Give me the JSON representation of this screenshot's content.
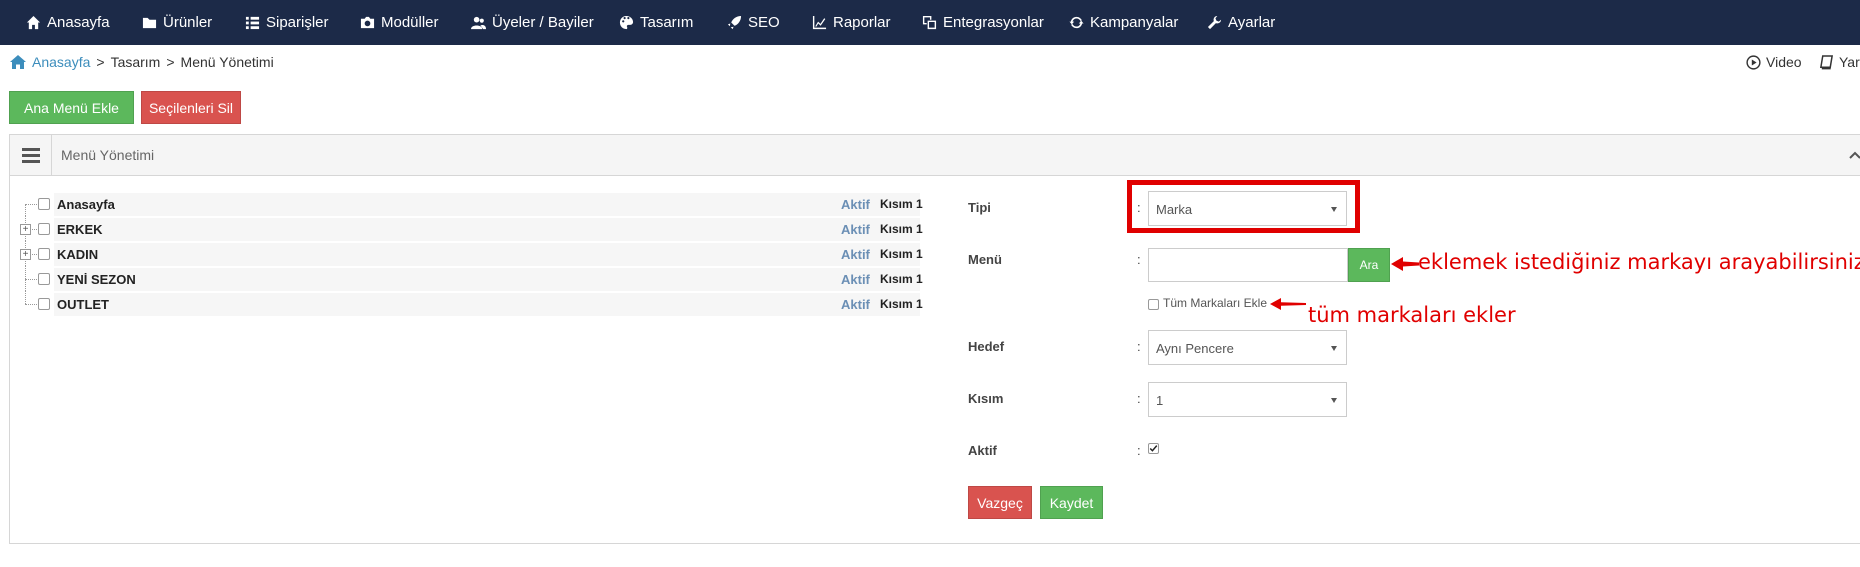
{
  "nav": {
    "items": [
      {
        "label": "Anasayfa",
        "icon": "home-icon"
      },
      {
        "label": "Ürünler",
        "icon": "folder-icon"
      },
      {
        "label": "Siparişler",
        "icon": "list-icon"
      },
      {
        "label": "Modüller",
        "icon": "module-icon"
      },
      {
        "label": "Üyeler / Bayiler",
        "icon": "users-icon"
      },
      {
        "label": "Tasarım",
        "icon": "palette-icon"
      },
      {
        "label": "SEO",
        "icon": "rocket-icon"
      },
      {
        "label": "Raporlar",
        "icon": "chart-icon"
      },
      {
        "label": "Entegrasyonlar",
        "icon": "integration-icon"
      },
      {
        "label": "Kampanyalar",
        "icon": "refresh-icon"
      },
      {
        "label": "Ayarlar",
        "icon": "wrench-icon"
      }
    ]
  },
  "breadcrumb": {
    "home": "Anasayfa",
    "items": [
      "Tasarım",
      "Menü Yönetimi"
    ],
    "separator": ">"
  },
  "top_right": {
    "video": "Video",
    "help": "Yard"
  },
  "toolbar": {
    "add_main_menu": "Ana Menü Ekle",
    "delete_selected": "Seçilenleri Sil"
  },
  "panel": {
    "title": "Menü Yönetimi"
  },
  "tree": {
    "rows": [
      {
        "name": "Anasayfa",
        "status": "Aktif",
        "section": "Kısım 1",
        "expandable": false
      },
      {
        "name": "ERKEK",
        "status": "Aktif",
        "section": "Kısım 1",
        "expandable": true
      },
      {
        "name": "KADIN",
        "status": "Aktif",
        "section": "Kısım 1",
        "expandable": true
      },
      {
        "name": "YENİ SEZON",
        "status": "Aktif",
        "section": "Kısım 1",
        "expandable": false
      },
      {
        "name": "OUTLET",
        "status": "Aktif",
        "section": "Kısım 1",
        "expandable": false
      }
    ]
  },
  "form": {
    "colon": ":",
    "type_label": "Tipi",
    "type_value": "Marka",
    "menu_label": "Menü",
    "menu_value": "",
    "search_button": "Ara",
    "all_brands_label": "Tüm Markaları Ekle",
    "target_label": "Hedef",
    "target_value": "Aynı Pencere",
    "section_label": "Kısım",
    "section_value": "1",
    "active_label": "Aktif",
    "active_checked": true,
    "cancel_button": "Vazgeç",
    "save_button": "Kaydet"
  },
  "annotations": {
    "search_note": "eklemek istediğiniz markayı arayabilirsiniz.",
    "all_brands_note": "tüm markaları ekler",
    "color": "#e00000"
  },
  "colors": {
    "nav_bg": "#1c2a48",
    "green": "#5cb85c",
    "red": "#d9534f",
    "link": "#3c8dbc"
  }
}
